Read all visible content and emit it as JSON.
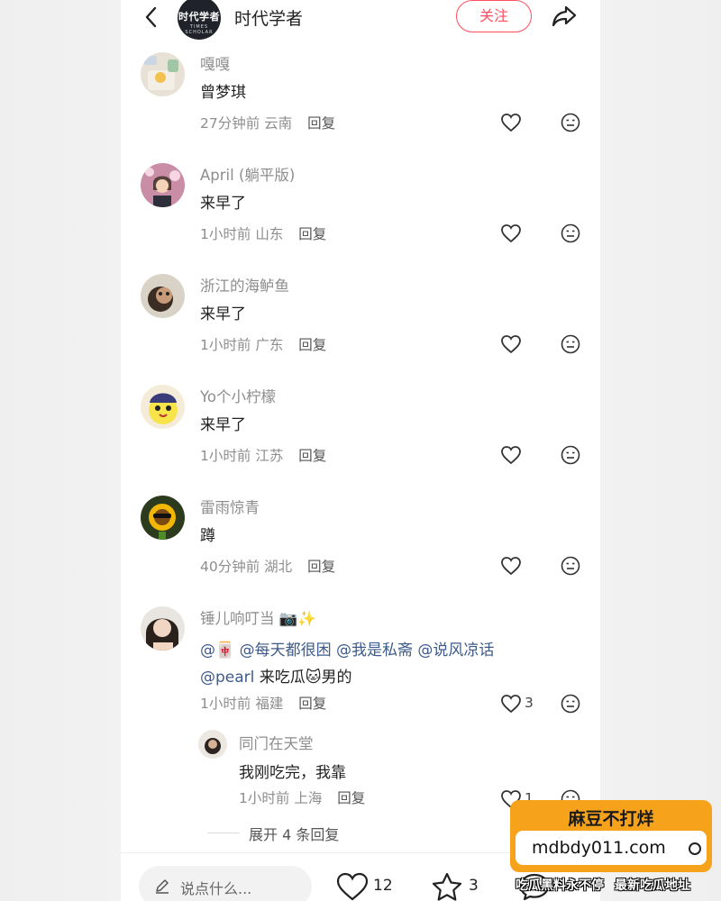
{
  "header": {
    "avatar_line1": "时代学者",
    "avatar_line2": "TIMES SCHOLAR",
    "title": "时代学者",
    "follow_label": "关注"
  },
  "comments": [
    {
      "user": "嘎嘎",
      "text": "曾梦琪",
      "time": "27分钟前",
      "location": "云南",
      "reply_label": "回复"
    },
    {
      "user": "April (躺平版)",
      "text": "来早了",
      "time": "1小时前",
      "location": "山东",
      "reply_label": "回复"
    },
    {
      "user": "浙江的海鲈鱼",
      "text": "来早了",
      "time": "1小时前",
      "location": "广东",
      "reply_label": "回复"
    },
    {
      "user": "Yo个小柠檬",
      "text": "来早了",
      "time": "1小时前",
      "location": "江苏",
      "reply_label": "回复"
    },
    {
      "user": "雷雨惊青",
      "text": "蹲",
      "time": "40分钟前",
      "location": "湖北",
      "reply_label": "回复"
    },
    {
      "user": "锤儿响叮当",
      "user_emoji": "📷✨",
      "text_line1": [
        "@",
        "🀄",
        " @每天都很困 @我是私斋 @说风凉话"
      ],
      "mention_1": "@每天都很困 @我是私斋 @说风凉话",
      "mention_2": "@pearl",
      "text_line2_rest": " 来吃瓜",
      "text_line2_emoji": "🐱",
      "text_line2_end": "男的",
      "time": "1小时前",
      "location": "福建",
      "reply_label": "回复",
      "like_count": "3",
      "reply": {
        "user": "同门在天堂",
        "text": "我刚吃完，我靠",
        "time": "1小时前",
        "location": "上海",
        "reply_label": "回复",
        "like_count": "1"
      }
    }
  ],
  "expand_label": "展开 4 条回复",
  "bottom_bar": {
    "input_placeholder": "说点什么...",
    "like_count": "12",
    "star_count": "3"
  },
  "promo": {
    "title": "麻豆不打烊",
    "url": "mdbdy011.com",
    "foot_left": "吃瓜黑料永不停",
    "foot_right": "最新吃瓜地址"
  },
  "colors": {
    "follow_red": "#ff4e5e",
    "mention_blue": "#3d5b8a",
    "promo_orange": "#f6a21a",
    "meta_gray": "#8e8e8e"
  }
}
